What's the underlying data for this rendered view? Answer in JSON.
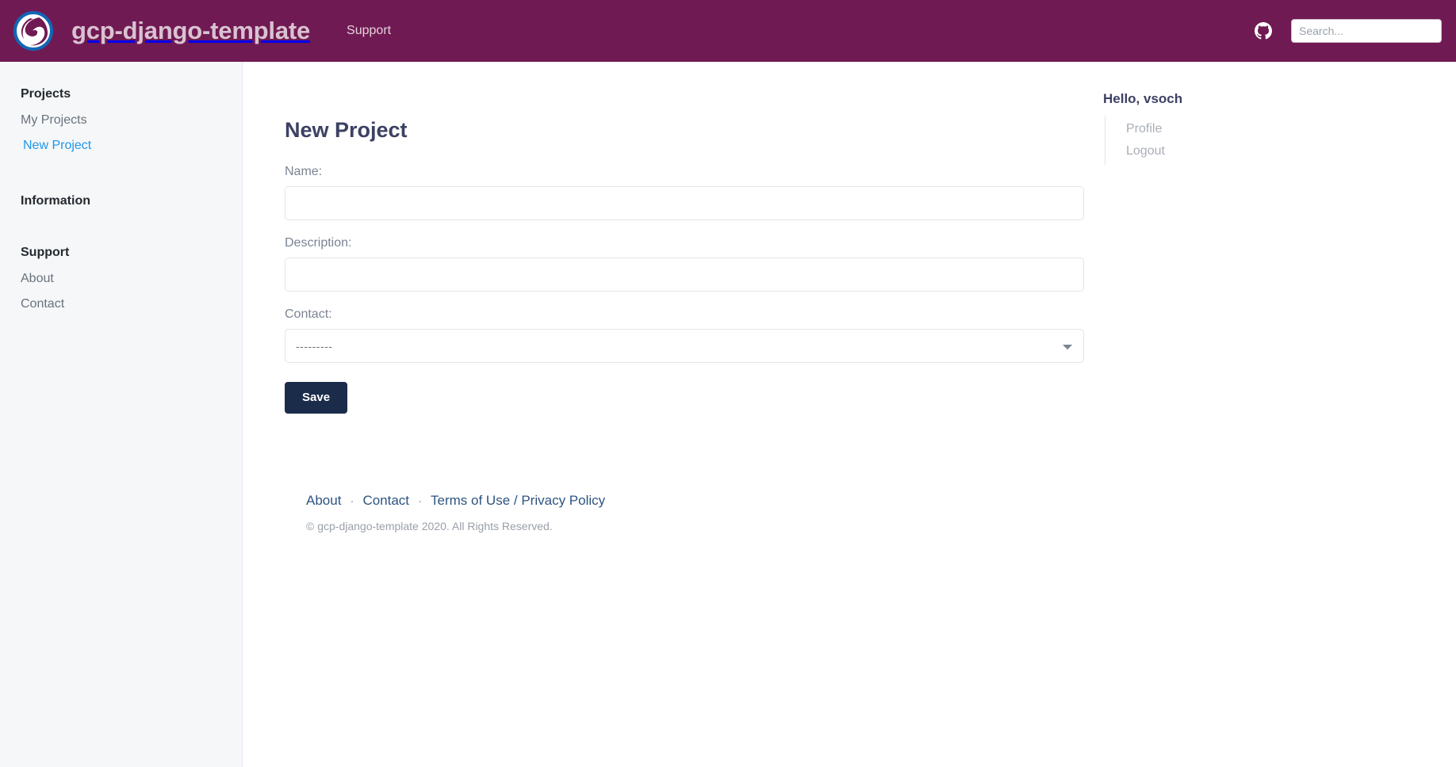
{
  "header": {
    "logo_icon": "swirl-circle-logo",
    "brand_title": "gcp-django-template",
    "nav_links": [
      {
        "label": "Support"
      }
    ],
    "github_icon": "github-icon",
    "search": {
      "placeholder": "Search...",
      "value": ""
    }
  },
  "sidebar": {
    "sections": [
      {
        "heading": "Projects",
        "items": [
          {
            "label": "My Projects",
            "active": false
          },
          {
            "label": "New Project",
            "active": true
          }
        ]
      },
      {
        "heading": "Information",
        "items": []
      },
      {
        "heading": "Support",
        "items": [
          {
            "label": "About",
            "active": false
          },
          {
            "label": "Contact",
            "active": false
          }
        ]
      }
    ]
  },
  "main": {
    "page_title": "New Project",
    "form": {
      "name": {
        "label": "Name:",
        "value": "",
        "placeholder": ""
      },
      "description": {
        "label": "Description:",
        "value": "",
        "placeholder": ""
      },
      "contact": {
        "label": "Contact:",
        "selected": "---------",
        "options": [
          "---------"
        ]
      },
      "save_label": "Save"
    }
  },
  "footer": {
    "links": [
      {
        "label": "About"
      },
      {
        "label": "Contact"
      },
      {
        "label": "Terms of Use / Privacy Policy"
      }
    ],
    "separator": "·",
    "copyright": "© gcp-django-template 2020. All Rights Reserved."
  },
  "right_panel": {
    "greeting": "Hello, vsoch",
    "items": [
      {
        "label": "Profile"
      },
      {
        "label": "Logout"
      }
    ]
  },
  "colors": {
    "header_purple": "#701A53",
    "accent_blue": "#2196e8",
    "save_navy": "#1b2c4a",
    "title_slate": "#3c4163",
    "footer_link": "#2e5481",
    "sidebar_bg": "#f5f7f9"
  }
}
